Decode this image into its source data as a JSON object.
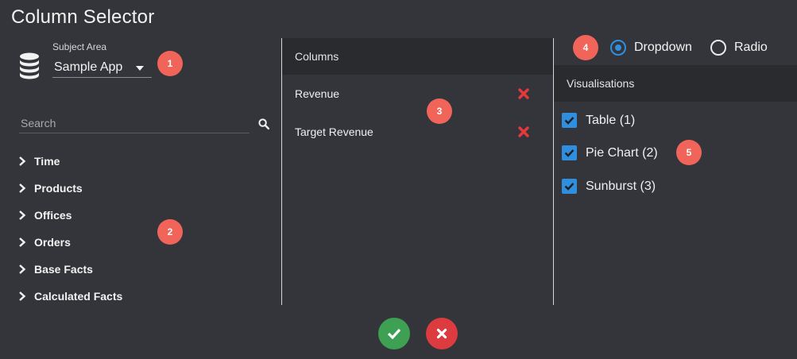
{
  "window": {
    "title": "Column Selector"
  },
  "subject_area": {
    "label": "Subject Area",
    "selected": "Sample App",
    "icon": "database-icon"
  },
  "search": {
    "placeholder": "Search",
    "value": ""
  },
  "tree": {
    "items": [
      {
        "label": "Time"
      },
      {
        "label": "Products"
      },
      {
        "label": "Offices"
      },
      {
        "label": "Orders"
      },
      {
        "label": "Base Facts"
      },
      {
        "label": "Calculated Facts"
      }
    ]
  },
  "columns": {
    "header": "Columns",
    "items": [
      {
        "label": "Revenue"
      },
      {
        "label": "Target Revenue"
      }
    ]
  },
  "mode": {
    "options": [
      {
        "label": "Dropdown",
        "selected": true
      },
      {
        "label": "Radio",
        "selected": false
      }
    ]
  },
  "visualisations": {
    "header": "Visualisations",
    "items": [
      {
        "label": "Table (1)",
        "checked": true
      },
      {
        "label": "Pie Chart (2)",
        "checked": true
      },
      {
        "label": "Sunburst (3)",
        "checked": true
      }
    ]
  },
  "badges": [
    "1",
    "2",
    "3",
    "4",
    "5"
  ],
  "colors": {
    "background": "#34353b",
    "header": "#2a2b2f",
    "accent": "#2f8fde",
    "badge": "#f0645a",
    "confirm": "#3ea052",
    "cancel": "#dc3b3f",
    "remove": "#e5393e"
  }
}
